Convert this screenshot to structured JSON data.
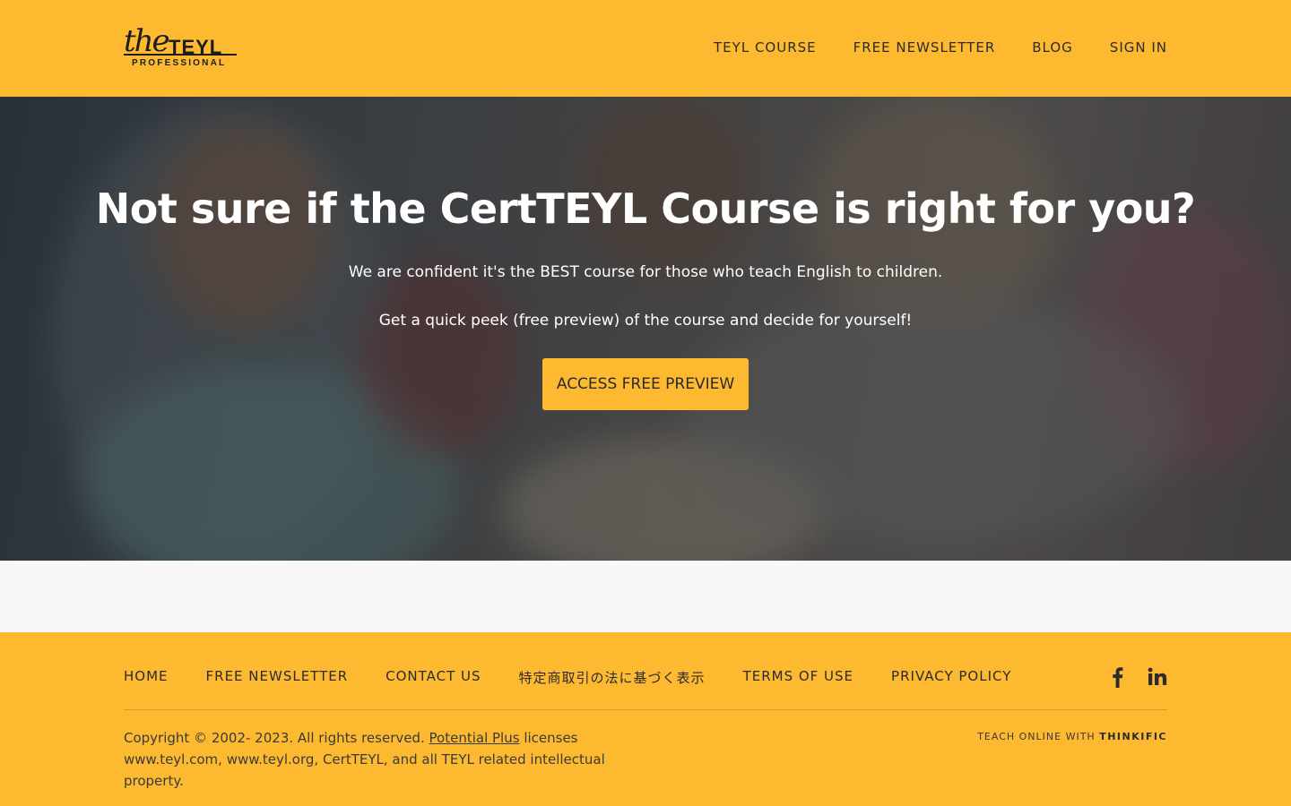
{
  "header": {
    "logo": {
      "script": "the",
      "brand": "TEYL",
      "tagline": "PROFESSIONAL"
    },
    "nav": [
      {
        "label": "TEYL COURSE"
      },
      {
        "label": "FREE NEWSLETTER"
      },
      {
        "label": "BLOG"
      },
      {
        "label": "SIGN IN"
      }
    ]
  },
  "hero": {
    "title": "Not sure if the CertTEYL Course is right for you?",
    "subtitle_1": "We are confident it's the BEST course for those who teach English to children.",
    "subtitle_2": "Get a quick peek (free preview) of the course and decide for yourself!",
    "cta_label": "ACCESS FREE PREVIEW"
  },
  "footer": {
    "nav": [
      {
        "label": "HOME"
      },
      {
        "label": "FREE NEWSLETTER"
      },
      {
        "label": "CONTACT US"
      },
      {
        "label": "特定商取引の法に基づく表示"
      },
      {
        "label": "TERMS OF USE"
      },
      {
        "label": "PRIVACY POLICY"
      }
    ],
    "social": [
      "facebook-icon",
      "linkedin-icon"
    ],
    "copyright_pre": "Copyright © 2002- 2023. All rights reserved. ",
    "copyright_link": "Potential Plus",
    "copyright_post": " licenses www.teyl.com, www.teyl.org, CertTEYL, and all TEYL related intellectual property.",
    "powered_prefix": "TEACH ONLINE WITH ",
    "powered_brand": "THINKIFIC"
  },
  "colors": {
    "accent": "#fdba31",
    "text_dark": "#2b2b2b",
    "hero_overlay": "#14181c"
  }
}
